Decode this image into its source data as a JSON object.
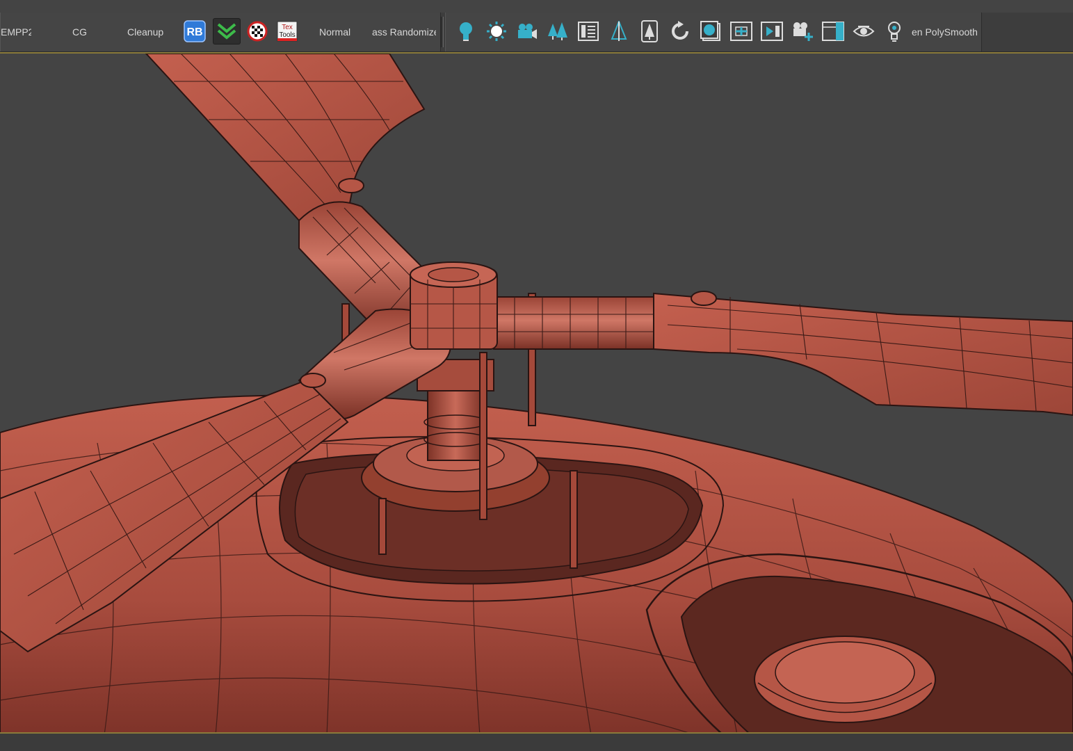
{
  "toolbar": {
    "left_group": {
      "items": [
        {
          "label": "EMPP2"
        },
        {
          "label": "CG"
        },
        {
          "label": "Cleanup"
        },
        {
          "label": "RB",
          "icon": "rb-script-icon"
        },
        {
          "icon": "double-chevron-down-icon"
        },
        {
          "icon": "checker-map-icon"
        },
        {
          "label": "Tex Tools",
          "icon": "textools-icon"
        },
        {
          "label": "Normal"
        },
        {
          "label": "ass Randomize"
        }
      ]
    },
    "right_group": {
      "icons": [
        "light-bulb-icon",
        "sun-light-icon",
        "camera-icon",
        "forest-icon",
        "list-panel-icon",
        "tree-icon",
        "tree-card-icon",
        "rotate-icon",
        "render-frame-icon",
        "safe-frame-icon",
        "play-frame-icon",
        "camera-add-icon",
        "viewport-frame-icon",
        "eye-icon",
        "bulb-outline-icon"
      ],
      "last_label": "en PolySmooth"
    },
    "colors": {
      "accent_teal": "#36b0c9",
      "rb_blue": "#2f7ad8",
      "check_green": "#3dbb4a"
    }
  },
  "viewport": {
    "background": "#444444",
    "model_color": "#b85a4a",
    "wire_color": "#2a1412"
  }
}
